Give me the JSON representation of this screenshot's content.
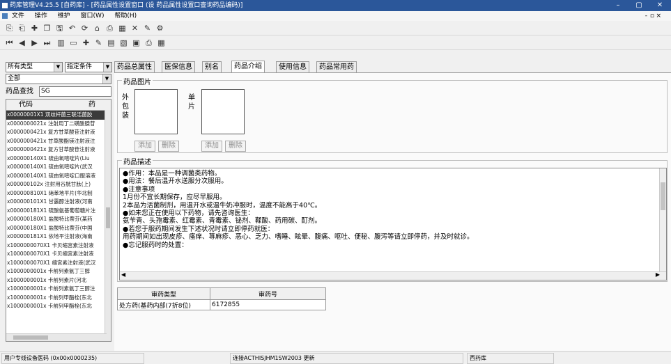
{
  "window": {
    "title": "药库管理V4.25.5 [自药库] - [药品属性设置窗口 (设 药品属性设置口查询药品编码)]",
    "min": "–",
    "max": "▢",
    "close": "✕",
    "sub_min": "-",
    "sub_max": "▫",
    "sub_close": "×"
  },
  "menu": [
    "文件",
    "操作",
    "维护",
    "窗口(W)",
    "帮助(H)"
  ],
  "toolbar1": [
    "copy-icon",
    "paste-icon",
    "new-icon",
    "duplicate-icon",
    "save-icon",
    "undo-icon",
    "refresh-icon",
    "lock-icon",
    "print-icon",
    "grid-icon",
    "delete-icon",
    "edit-icon",
    "settings-icon"
  ],
  "toolbar1_glyphs": [
    "⎘",
    "⎗",
    "✚",
    "❐",
    "🖫",
    "↶",
    "⟳",
    "⌂",
    "⎙",
    "▦",
    "✕",
    "✎",
    "⚙"
  ],
  "toolbar2_glyphs": [
    "⏮",
    "◀",
    "▶",
    "⏭",
    "▥",
    "▭",
    "✚",
    "✎",
    "▤",
    "▧",
    "▣",
    "⎙",
    "▦"
  ],
  "filters": {
    "type": "所有类型",
    "extra": "指定条件",
    "scope": "全部",
    "search_label": "药品查找",
    "search_value": "SG"
  },
  "left_list": {
    "header_code": "代码",
    "header_name": "药",
    "rows": [
      "x00000001X1 双歧杆菌三联活菌胶",
      "x0000000021x 注射用丁二磺酸腺苷",
      "x0000000421x 复方甘草酸苷注射液",
      "x0000000421x 甘草酸酯镁注射液注",
      "x0000000421x 复方甘草酸苷注射液",
      "x000000140X1 硫由氧嘧啶片(Liu",
      "x000000140X1 硫由氧嘧啶片(武汉",
      "x000000140X1 硫由氧嘧啶口服溶液",
      "x000000102x 注射用谷胱甘肽(上)",
      "x000000810X1 硝苯地平片(华北制",
      "x000000101X1 甘露醇注射液(河南",
      "x000000181X1 硫酸氨基葡萄糖片注",
      "x000000180X1 盐酸特比萘芬(某药",
      "x000000180X1 盐酸特比萘芬(中国",
      "x000000181X1 依地平注射液(海南",
      "x1000000070X1 卡贝缩宫素注射液",
      "x1000000070X1 卡贝缩宫素注射液",
      "x1000000070X1 缩宫素注射液(武汉",
      "x1000000001x 卡前列素氨丁三醇",
      "x1000000001x 卡前列素片(河北",
      "x1000000001x 卡前列素氨丁三醇注",
      "x1000000001x 卡前列甲酯栓(东北",
      "x1000000001x 卡前列甲酯栓(东北"
    ]
  },
  "tabs": [
    "药品总属性",
    "医保信息",
    "别名",
    "药品介绍",
    "使用信息",
    "药品常用药"
  ],
  "active_tab": 3,
  "image_section": {
    "legend": "药品图片",
    "outer_label": "外包装",
    "inner_label": "单片",
    "add": "添加",
    "delete": "删除"
  },
  "desc_section": {
    "legend": "药品描述",
    "lines": [
      "●作用：本品是一种调菌类药物。",
      "●用法：餐后温开水送服分次服用。",
      "●注意事项",
      "  1月份不宜长期保存，应尽早服用。",
      "  2本品为活菌制剂，用温开水或温牛奶冲服时，温度不能高于40℃。",
      "●如未您正在使用以下药物，请先咨询医生：",
      "  氨苄青、头孢霉素、红霉素、青霉素、铋剂、鞣酸、药用碳、酊剂。",
      "●若您于服药期间发生下述状况时请立即停药就医：",
      "用药期间如出现皮疹、瘙痒、荨麻疹、恶心、乏力、嗜睡、眩晕、腹痛、呕吐、便秘、腹泻等请立即停药，并及时就诊。",
      "●忘记服药时的处置："
    ]
  },
  "approval_table": {
    "headers": [
      "审药类型",
      "审药号"
    ],
    "rows": [
      [
        "处方药(基药内部(7折8位)",
        "6172855"
      ]
    ]
  },
  "status": {
    "left": "用户专线设备医码 (0x00x0000235)",
    "mid": "连接ACTHISJHM1SW2003 更新",
    "right": "西药库"
  }
}
